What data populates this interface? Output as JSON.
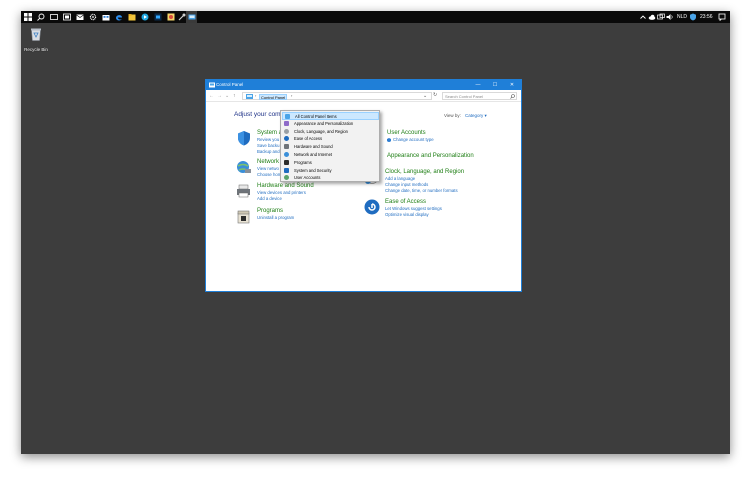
{
  "taskbar": {
    "icons": [
      "windows-start-icon",
      "search-icon",
      "task-view-icon",
      "folder-icon",
      "mail-icon",
      "settings-gear-icon",
      "store-icon",
      "edge-browser-icon",
      "file-explorer-icon",
      "media-player-icon",
      "photoshop-icon",
      "paint-icon",
      "control-panel-icon"
    ],
    "language": "NLD",
    "time": "23:56"
  },
  "desktop": {
    "recycle_bin_label": "Recycle Bin"
  },
  "window": {
    "title": "Control Panel",
    "minimize_glyph": "—",
    "maximize_glyph": "☐",
    "close_glyph": "✕",
    "breadcrumb": "Control Panel",
    "search_placeholder": "Search Control Panel",
    "heading": "Adjust your comp",
    "view_by_label": "View by:",
    "view_by_value": "Category ▾"
  },
  "categories_left": [
    {
      "head": "System a",
      "links": [
        "Review you",
        "Save backu",
        "Backup and"
      ]
    },
    {
      "head": "Network",
      "links": [
        "View netwo",
        "Choose homegroup and sharing options"
      ]
    },
    {
      "head": "Hardware and Sound",
      "links": [
        "View devices and printers",
        "Add a device"
      ]
    },
    {
      "head": "Programs",
      "links": [
        "Uninstall a program"
      ]
    }
  ],
  "categories_right": [
    {
      "head": "User Accounts",
      "links": [
        "Change account type"
      ]
    },
    {
      "head": "Appearance and Personalization",
      "links": []
    },
    {
      "head": "Clock, Language, and Region",
      "links": [
        "Add a language",
        "Change input methods",
        "Change date, time, or number formats"
      ]
    },
    {
      "head": "Ease of Access",
      "links": [
        "Let Windows suggest settings",
        "Optimize visual display"
      ]
    }
  ],
  "dropdown": {
    "items": [
      "All Control Panel Items",
      "Appearance and Personalization",
      "Clock, Language, and Region",
      "Ease of Access",
      "Hardware and Sound",
      "Network and Internet",
      "Programs",
      "System and Security",
      "User Accounts"
    ],
    "selected_index": 0
  },
  "colors": {
    "desktop_bg": "#3d3d3d",
    "title_bar": "#1f7fd8",
    "category_head": "#1e7e14",
    "link": "#1f6cc0"
  }
}
